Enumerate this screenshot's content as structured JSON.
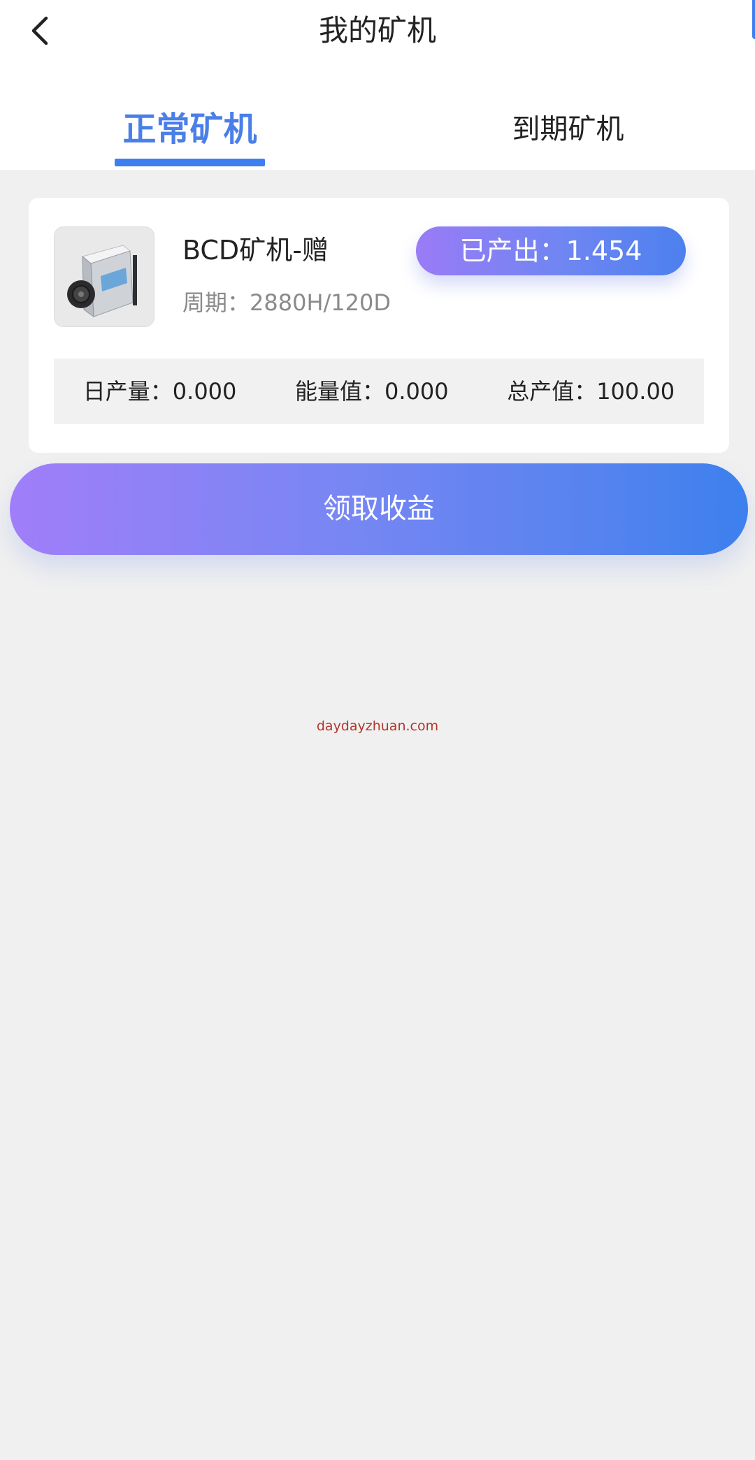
{
  "header": {
    "title": "我的矿机",
    "back_icon": "chevron-left-icon"
  },
  "tabs": [
    {
      "label": "正常矿机",
      "active": true
    },
    {
      "label": "到期矿机",
      "active": false
    }
  ],
  "machine": {
    "name": "BCD矿机-赠",
    "cycle": "周期：2880H/120D",
    "output": "已产出：1.454",
    "stats": [
      {
        "text": "日产量：0.000"
      },
      {
        "text": "能量值：0.000"
      },
      {
        "text": "总产值：100.00"
      }
    ]
  },
  "actions": {
    "claim_label": "领取收益"
  },
  "watermark": "daydayzhuan.com",
  "colors": {
    "accent": "#3d7ff0",
    "gradient_start": "#a07ef9",
    "gradient_end": "#3c80ee",
    "background": "#f0f0f0"
  }
}
